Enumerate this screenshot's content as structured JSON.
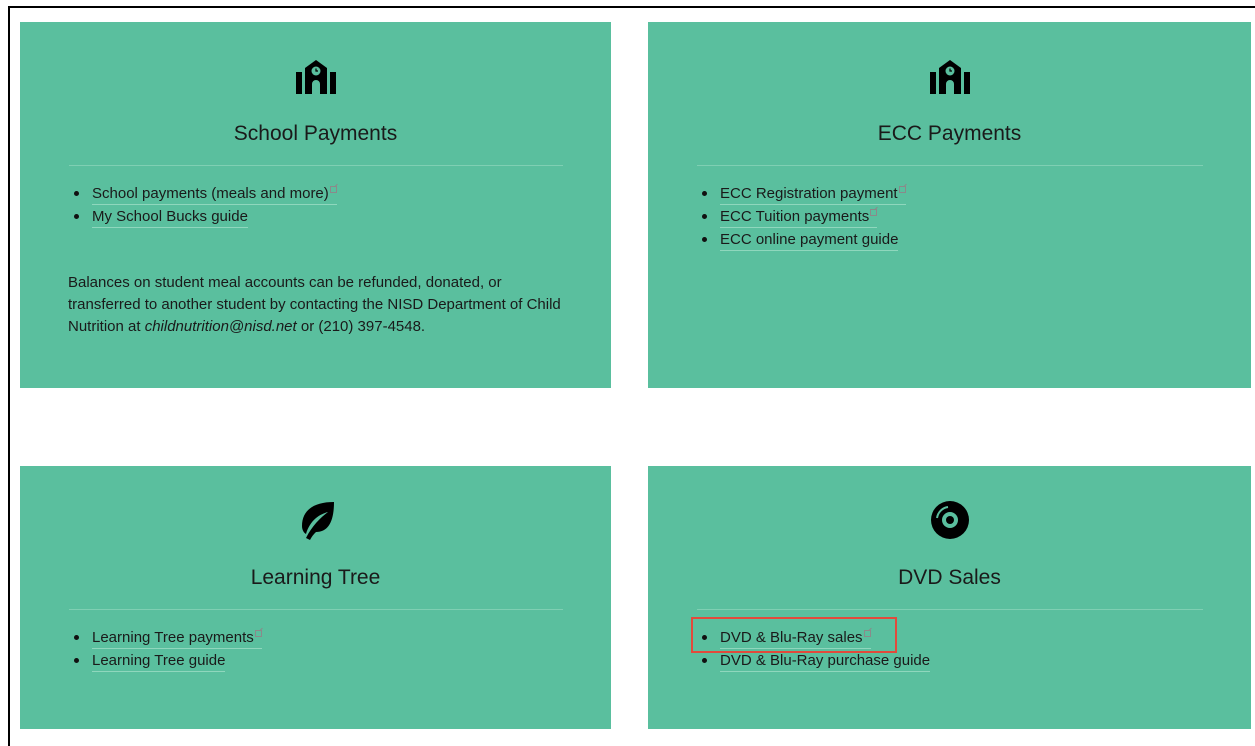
{
  "cards": {
    "school": {
      "title": "School Payments",
      "icon": "school-icon",
      "links": [
        {
          "label": "School payments (meals and more)",
          "external": true
        },
        {
          "label": "My School Bucks guide",
          "external": false
        }
      ],
      "note_prefix": "Balances on student meal accounts can be refunded, donated, or transferred to another student by contacting the NISD Department of Child Nutrition at ",
      "note_email": "childnutrition@nisd.net",
      "note_suffix": " or (210) 397-4548."
    },
    "ecc": {
      "title": "ECC Payments",
      "icon": "school-icon",
      "links": [
        {
          "label": "ECC Registration payment",
          "external": true
        },
        {
          "label": "ECC Tuition payments",
          "external": true
        },
        {
          "label": "ECC online payment guide",
          "external": false
        }
      ]
    },
    "learning": {
      "title": "Learning Tree",
      "icon": "leaf-icon",
      "links": [
        {
          "label": "Learning Tree payments",
          "external": true
        },
        {
          "label": "Learning Tree guide",
          "external": false
        }
      ]
    },
    "dvd": {
      "title": "DVD Sales",
      "icon": "disc-icon",
      "links": [
        {
          "label": "DVD & Blu-Ray sales",
          "external": true
        },
        {
          "label": "DVD & Blu-Ray purchase guide",
          "external": false
        }
      ]
    }
  },
  "colors": {
    "card_bg": "#5abf9e",
    "highlight": "#e24a3b"
  }
}
